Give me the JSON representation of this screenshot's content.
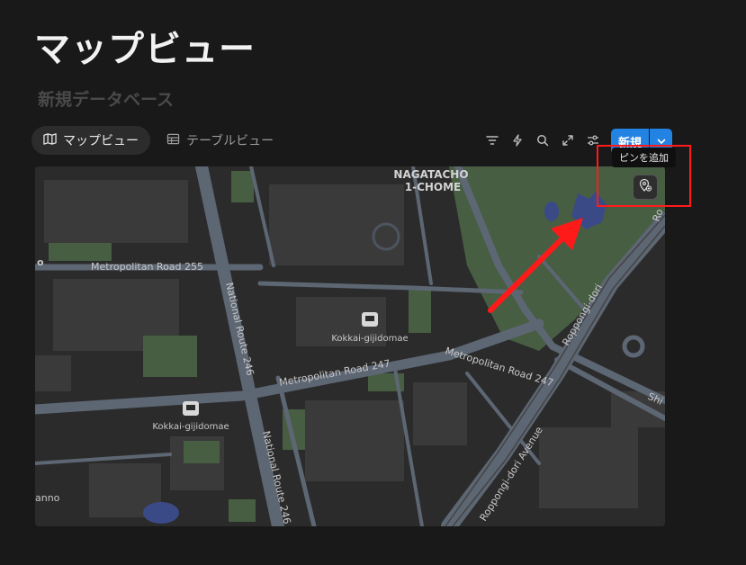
{
  "page": {
    "title": "マップビュー",
    "subtitle": "新規データベース"
  },
  "views": {
    "map_tab": "マップビュー",
    "table_tab": "テーブルビュー"
  },
  "toolbar": {
    "new_label": "新規",
    "icons": [
      "filter-icon",
      "lightning-icon",
      "search-icon",
      "expand-icon",
      "sliders-icon",
      "chevron-down-icon"
    ]
  },
  "tooltip": {
    "text": "ピンを追加"
  },
  "map": {
    "labels": {
      "district_line1": "NAGATACHO",
      "district_line2": "1-CHOME",
      "road_metro255": "Metropolitan Road 255",
      "road_metro247_a": "Metropolitan Road 247",
      "road_metro247_b": "Metropolitan Road 247",
      "route246_a": "National Route 246",
      "route246_b": "National Route 246",
      "station1": "Kokkai-gijidomae",
      "station2": "Kokkai-gijidomae",
      "roppongi_dori": "Roppongi-dori",
      "roppongi_dori_avenue": "Roppongi-dori Avenue",
      "edge_o": "o",
      "edge_anno": "anno",
      "edge_shi": "Shi",
      "edge_ro": "Ro"
    }
  },
  "colors": {
    "background": "#191919",
    "accent": "#2383e2",
    "highlight": "#ff1a1a",
    "map_park": "#475e43",
    "map_road": "#5d6673",
    "map_water": "#3a4a86"
  }
}
